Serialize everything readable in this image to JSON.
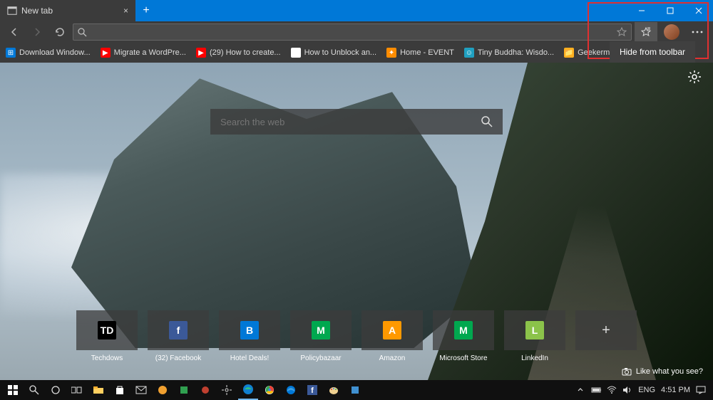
{
  "titlebar": {
    "tab_title": "New tab",
    "close": "×"
  },
  "bookmarks": [
    {
      "label": "Download Window...",
      "color": "#0078d7",
      "icon": "⊞"
    },
    {
      "label": "Migrate a WordPre...",
      "color": "#ff0000",
      "icon": "▶"
    },
    {
      "label": "(29) How to create...",
      "color": "#ff0000",
      "icon": "▶"
    },
    {
      "label": "How to Unblock an...",
      "color": "#fff",
      "icon": "🗎"
    },
    {
      "label": "Home - EVENT",
      "color": "#ff8c00",
      "icon": "✦"
    },
    {
      "label": "Tiny Buddha: Wisdo...",
      "color": "#20a0c0",
      "icon": "☺"
    },
    {
      "label": "Geekermag",
      "color": "#ffb020",
      "icon": "📁"
    }
  ],
  "context_menu": {
    "item": "Hide from toolbar"
  },
  "search": {
    "placeholder": "Search the web"
  },
  "tiles": [
    {
      "label": "Techdows",
      "bg": "#000",
      "fg": "#fff",
      "text": "TD"
    },
    {
      "label": "(32) Facebook",
      "bg": "#3b5998",
      "fg": "#fff",
      "text": "f"
    },
    {
      "label": "Hotel Deals!",
      "bg": "#0078d7",
      "fg": "#fff",
      "text": "B"
    },
    {
      "label": "Policybazaar",
      "bg": "#00a84f",
      "fg": "#fff",
      "text": "M"
    },
    {
      "label": "Amazon",
      "bg": "#ff9900",
      "fg": "#fff",
      "text": "A"
    },
    {
      "label": "Microsoft Store",
      "bg": "#00a84f",
      "fg": "#fff",
      "text": "M"
    },
    {
      "label": "LinkedIn",
      "bg": "#8bc34a",
      "fg": "#fff",
      "text": "L"
    }
  ],
  "like_label": "Like what you see?",
  "systray": {
    "lang": "ENG",
    "time": "4:51 PM"
  }
}
